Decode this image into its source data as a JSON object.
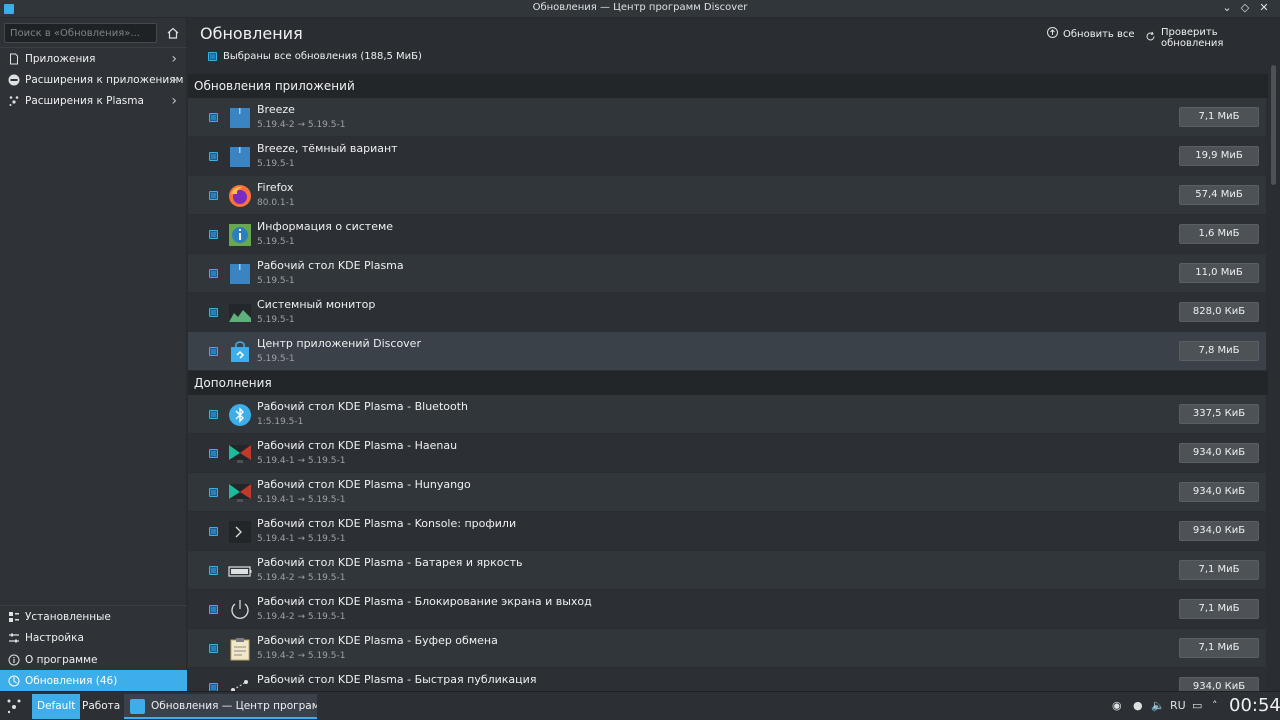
{
  "window": {
    "title": "Обновления — Центр программ Discover"
  },
  "sidebar": {
    "search_placeholder": "Поиск в «Обновления»...",
    "categories": [
      {
        "label": "Приложения",
        "icon": "document-icon"
      },
      {
        "label": "Расширения к приложениям",
        "icon": "plugin-icon"
      },
      {
        "label": "Расширения к Plasma",
        "icon": "plasma-icon"
      }
    ],
    "bottom": [
      {
        "label": "Установленные",
        "icon": "installed-icon"
      },
      {
        "label": "Настройка",
        "icon": "settings-icon"
      },
      {
        "label": "О программе",
        "icon": "info-icon"
      },
      {
        "label": "Обновления (46)",
        "icon": "updates-icon",
        "active": true
      }
    ]
  },
  "main": {
    "title": "Обновления",
    "update_all_label": "Обновить все",
    "check_updates_label": "Проверить обновления",
    "select_all_label": "Выбраны все обновления (188,5 МиБ)",
    "sections": [
      {
        "title": "Обновления приложений",
        "items": [
          {
            "name": "Breeze",
            "version": "5.19.4-2 → 5.19.5-1",
            "size": "7,1 МиБ",
            "icon": "package-icon"
          },
          {
            "name": "Breeze, тёмный вариант",
            "version": "5.19.5-1",
            "size": "19,9 МиБ",
            "icon": "package-icon"
          },
          {
            "name": "Firefox",
            "version": "80.0.1-1",
            "size": "57,4 МиБ",
            "icon": "firefox-icon"
          },
          {
            "name": "Информация о системе",
            "version": "5.19.5-1",
            "size": "1,6 МиБ",
            "icon": "sysinfo-icon"
          },
          {
            "name": "Рабочий стол KDE Plasma",
            "version": "5.19.5-1",
            "size": "11,0 МиБ",
            "icon": "package-icon"
          },
          {
            "name": "Системный монитор",
            "version": "5.19.5-1",
            "size": "828,0 КиБ",
            "icon": "sysmonitor-icon"
          },
          {
            "name": "Центр приложений Discover",
            "version": "5.19.5-1",
            "size": "7,8 МиБ",
            "icon": "discover-icon"
          }
        ]
      },
      {
        "title": "Дополнения",
        "items": [
          {
            "name": "Рабочий стол KDE Plasma - Bluetooth",
            "version": "1:5.19.5-1",
            "size": "337,5 КиБ",
            "icon": "bluetooth-icon"
          },
          {
            "name": "Рабочий стол KDE Plasma - Haenau",
            "version": "5.19.4-1 → 5.19.5-1",
            "size": "934,0 КиБ",
            "icon": "wallpaper-icon"
          },
          {
            "name": "Рабочий стол KDE Plasma - Hunyango",
            "version": "5.19.4-1 → 5.19.5-1",
            "size": "934,0 КиБ",
            "icon": "wallpaper-icon"
          },
          {
            "name": "Рабочий стол KDE Plasma - Konsole: профили",
            "version": "5.19.4-1 → 5.19.5-1",
            "size": "934,0 КиБ",
            "icon": "terminal-icon"
          },
          {
            "name": "Рабочий стол KDE Plasma - Батарея и яркость",
            "version": "5.19.4-2 → 5.19.5-1",
            "size": "7,1 МиБ",
            "icon": "battery-icon"
          },
          {
            "name": "Рабочий стол KDE Plasma - Блокирование экрана и выход",
            "version": "5.19.4-2 → 5.19.5-1",
            "size": "7,1 МиБ",
            "icon": "power-icon"
          },
          {
            "name": "Рабочий стол KDE Plasma - Буфер обмена",
            "version": "5.19.4-2 → 5.19.5-1",
            "size": "7,1 МиБ",
            "icon": "clipboard-icon"
          },
          {
            "name": "Рабочий стол KDE Plasma - Быстрая публикация",
            "version": "",
            "size": "934,0 КиБ",
            "icon": "share-icon"
          }
        ]
      }
    ]
  },
  "taskbar": {
    "desktops": [
      "Default",
      "Работа"
    ],
    "task_label": "Обновления — Центр программ ...",
    "keyboard_layout": "RU",
    "clock": "00:54"
  },
  "colors": {
    "accent": "#3daee9",
    "background": "#2a2e32",
    "row": "#31363b"
  }
}
